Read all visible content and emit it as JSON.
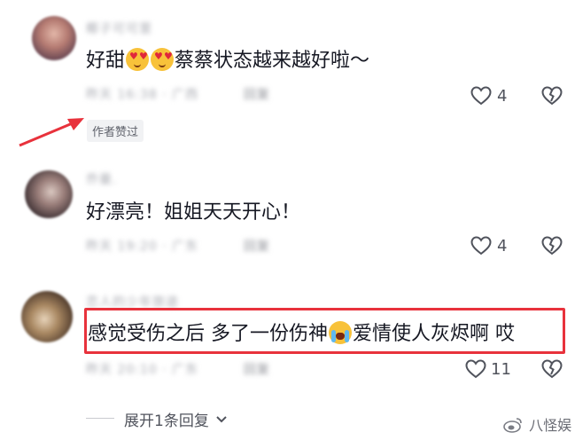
{
  "comments": [
    {
      "username": "椰子可可里",
      "content_before": "好甜",
      "content_after": "蔡蔡状态越来越好啦～",
      "meta": "昨天 16:38 · 广西",
      "reply_label": "回复",
      "like_count": "4",
      "author_badge": "作者赞过"
    },
    {
      "username": "乔曼.",
      "content": "好漂亮！姐姐天天开心！",
      "meta": "昨天 19:20 · 广东",
      "reply_label": "回复",
      "like_count": "4"
    },
    {
      "username": "恋人的少年旅途",
      "content_before": "感觉受伤之后 多了一份伤神",
      "content_after": "爱情使人灰烬啊 哎",
      "meta": "昨天 20:10 · 广东",
      "reply_label": "回复",
      "like_count": "11"
    }
  ],
  "expand_replies": "展开1条回复",
  "watermark": "八怪娱",
  "colors": {
    "highlight": "#e8323c",
    "arrow": "#e8323c",
    "text_primary": "#161823",
    "text_secondary": "#50535c"
  },
  "icons": {
    "like": "heart-outline-icon",
    "dislike": "broken-heart-icon",
    "expand": "chevron-down-icon",
    "watermark_logo": "weibo-icon"
  }
}
